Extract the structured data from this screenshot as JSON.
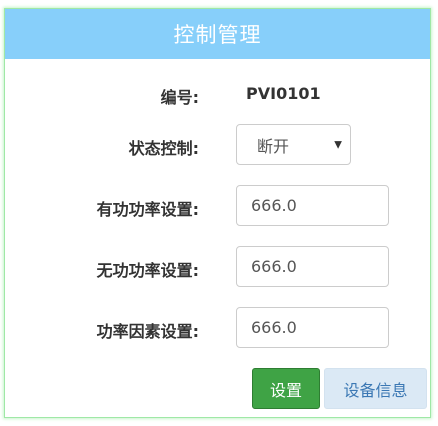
{
  "header": {
    "title": "控制管理"
  },
  "form": {
    "id_label": "编号:",
    "id_value": "PVI0101",
    "status_label": "状态控制:",
    "status_selected": "断开",
    "active_power_label": "有功功率设置:",
    "active_power_value": "666.0",
    "reactive_power_label": "无功功率设置:",
    "reactive_power_value": "666.0",
    "power_factor_label": "功率因素设置:",
    "power_factor_value": "666.0"
  },
  "buttons": {
    "set_label": "设置",
    "info_label": "设备信息"
  },
  "colors": {
    "header_bg": "#87cffa",
    "set_button_bg": "#3fa345",
    "info_button_bg": "#dbe9f5",
    "info_button_text": "#3b78b4",
    "panel_border": "#9fe8a6"
  },
  "icons": {
    "select_caret": "caret-down-icon"
  }
}
